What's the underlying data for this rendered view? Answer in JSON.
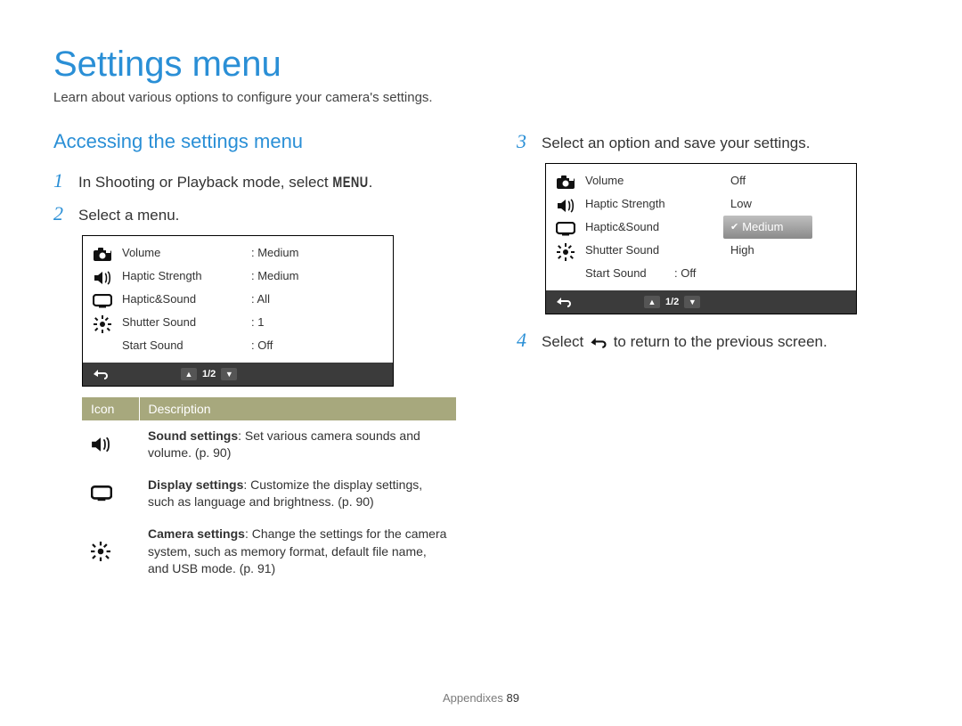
{
  "title": "Settings menu",
  "subtitle": "Learn about various options to configure your camera's settings.",
  "section_heading": "Accessing the settings menu",
  "steps": {
    "s1": {
      "num": "1",
      "pre": "In Shooting or Playback mode, select ",
      "menu_chip": "MENU",
      "post": "."
    },
    "s2": {
      "num": "2",
      "text": "Select a menu."
    },
    "s3": {
      "num": "3",
      "text": "Select an option and save your settings."
    },
    "s4": {
      "num": "4",
      "pre": "Select ",
      "post": " to return to the previous screen."
    }
  },
  "screen1": {
    "rows": [
      {
        "label": "Volume",
        "value": ": Medium"
      },
      {
        "label": "Haptic Strength",
        "value": ": Medium"
      },
      {
        "label": "Haptic&Sound",
        "value": ": All"
      },
      {
        "label": "Shutter Sound",
        "value": ": 1"
      },
      {
        "label": "Start Sound",
        "value": ": Off"
      }
    ],
    "page": "1/2"
  },
  "screen2": {
    "rows": [
      {
        "label": "Volume"
      },
      {
        "label": "Haptic Strength"
      },
      {
        "label": "Haptic&Sound"
      },
      {
        "label": "Shutter Sound"
      },
      {
        "label": "Start Sound",
        "value": ": Off"
      }
    ],
    "options": [
      "Off",
      "Low",
      "Medium",
      "High"
    ],
    "selected": "Medium",
    "page": "1/2"
  },
  "icon_table": {
    "head_icon": "Icon",
    "head_desc": "Description",
    "rows": [
      {
        "bold": "Sound settings",
        "rest": ": Set various camera sounds and volume. (p. 90)"
      },
      {
        "bold": "Display settings",
        "rest": ": Customize the display settings, such as language and brightness. (p. 90)"
      },
      {
        "bold": "Camera settings",
        "rest": ": Change the settings for the camera system, such as memory format, default file name, and USB mode. (p. 91)"
      }
    ]
  },
  "footer": {
    "label": "Appendixes",
    "page": "89"
  }
}
